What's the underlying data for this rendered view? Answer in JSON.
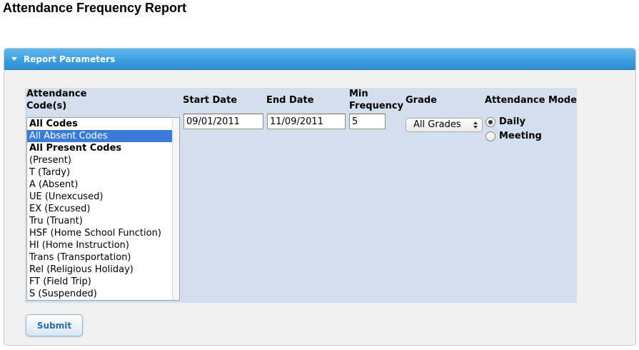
{
  "page": {
    "title": "Attendance Frequency Report"
  },
  "panel": {
    "header": "Report Parameters"
  },
  "form": {
    "codes_label_line1": "Attendance",
    "codes_label_line2": "Code(s)",
    "codes": [
      {
        "label": "All Codes",
        "bold": true,
        "selected": false
      },
      {
        "label": "All Absent Codes",
        "bold": false,
        "selected": true
      },
      {
        "label": "All Present Codes",
        "bold": true,
        "selected": false
      },
      {
        "label": "(Present)",
        "bold": false,
        "selected": false
      },
      {
        "label": "T (Tardy)",
        "bold": false,
        "selected": false
      },
      {
        "label": "A (Absent)",
        "bold": false,
        "selected": false
      },
      {
        "label": "UE (Unexcused)",
        "bold": false,
        "selected": false
      },
      {
        "label": "EX (Excused)",
        "bold": false,
        "selected": false
      },
      {
        "label": "Tru (Truant)",
        "bold": false,
        "selected": false
      },
      {
        "label": "HSF (Home School Function)",
        "bold": false,
        "selected": false
      },
      {
        "label": "HI (Home Instruction)",
        "bold": false,
        "selected": false
      },
      {
        "label": "Trans (Transportation)",
        "bold": false,
        "selected": false
      },
      {
        "label": "Rel (Religious Holiday)",
        "bold": false,
        "selected": false
      },
      {
        "label": "FT (Field Trip)",
        "bold": false,
        "selected": false
      },
      {
        "label": "S (Suspended)",
        "bold": false,
        "selected": false
      }
    ],
    "start_date_label": "Start Date",
    "start_date_value": "09/01/2011",
    "end_date_label": "End Date",
    "end_date_value": "11/09/2011",
    "min_freq_label_line1": "Min",
    "min_freq_label_line2": "Frequency",
    "min_freq_value": "5",
    "grade_label": "Grade",
    "grade_selected": "All Grades",
    "mode_label": "Attendance Mode",
    "mode_daily": "Daily",
    "mode_meeting": "Meeting",
    "mode_selected": "Daily"
  },
  "actions": {
    "submit_label": "Submit"
  },
  "colors": {
    "header_blue": "#3e9fdf",
    "selection_blue": "#3b7bd8",
    "form_background": "#d4dfee"
  }
}
